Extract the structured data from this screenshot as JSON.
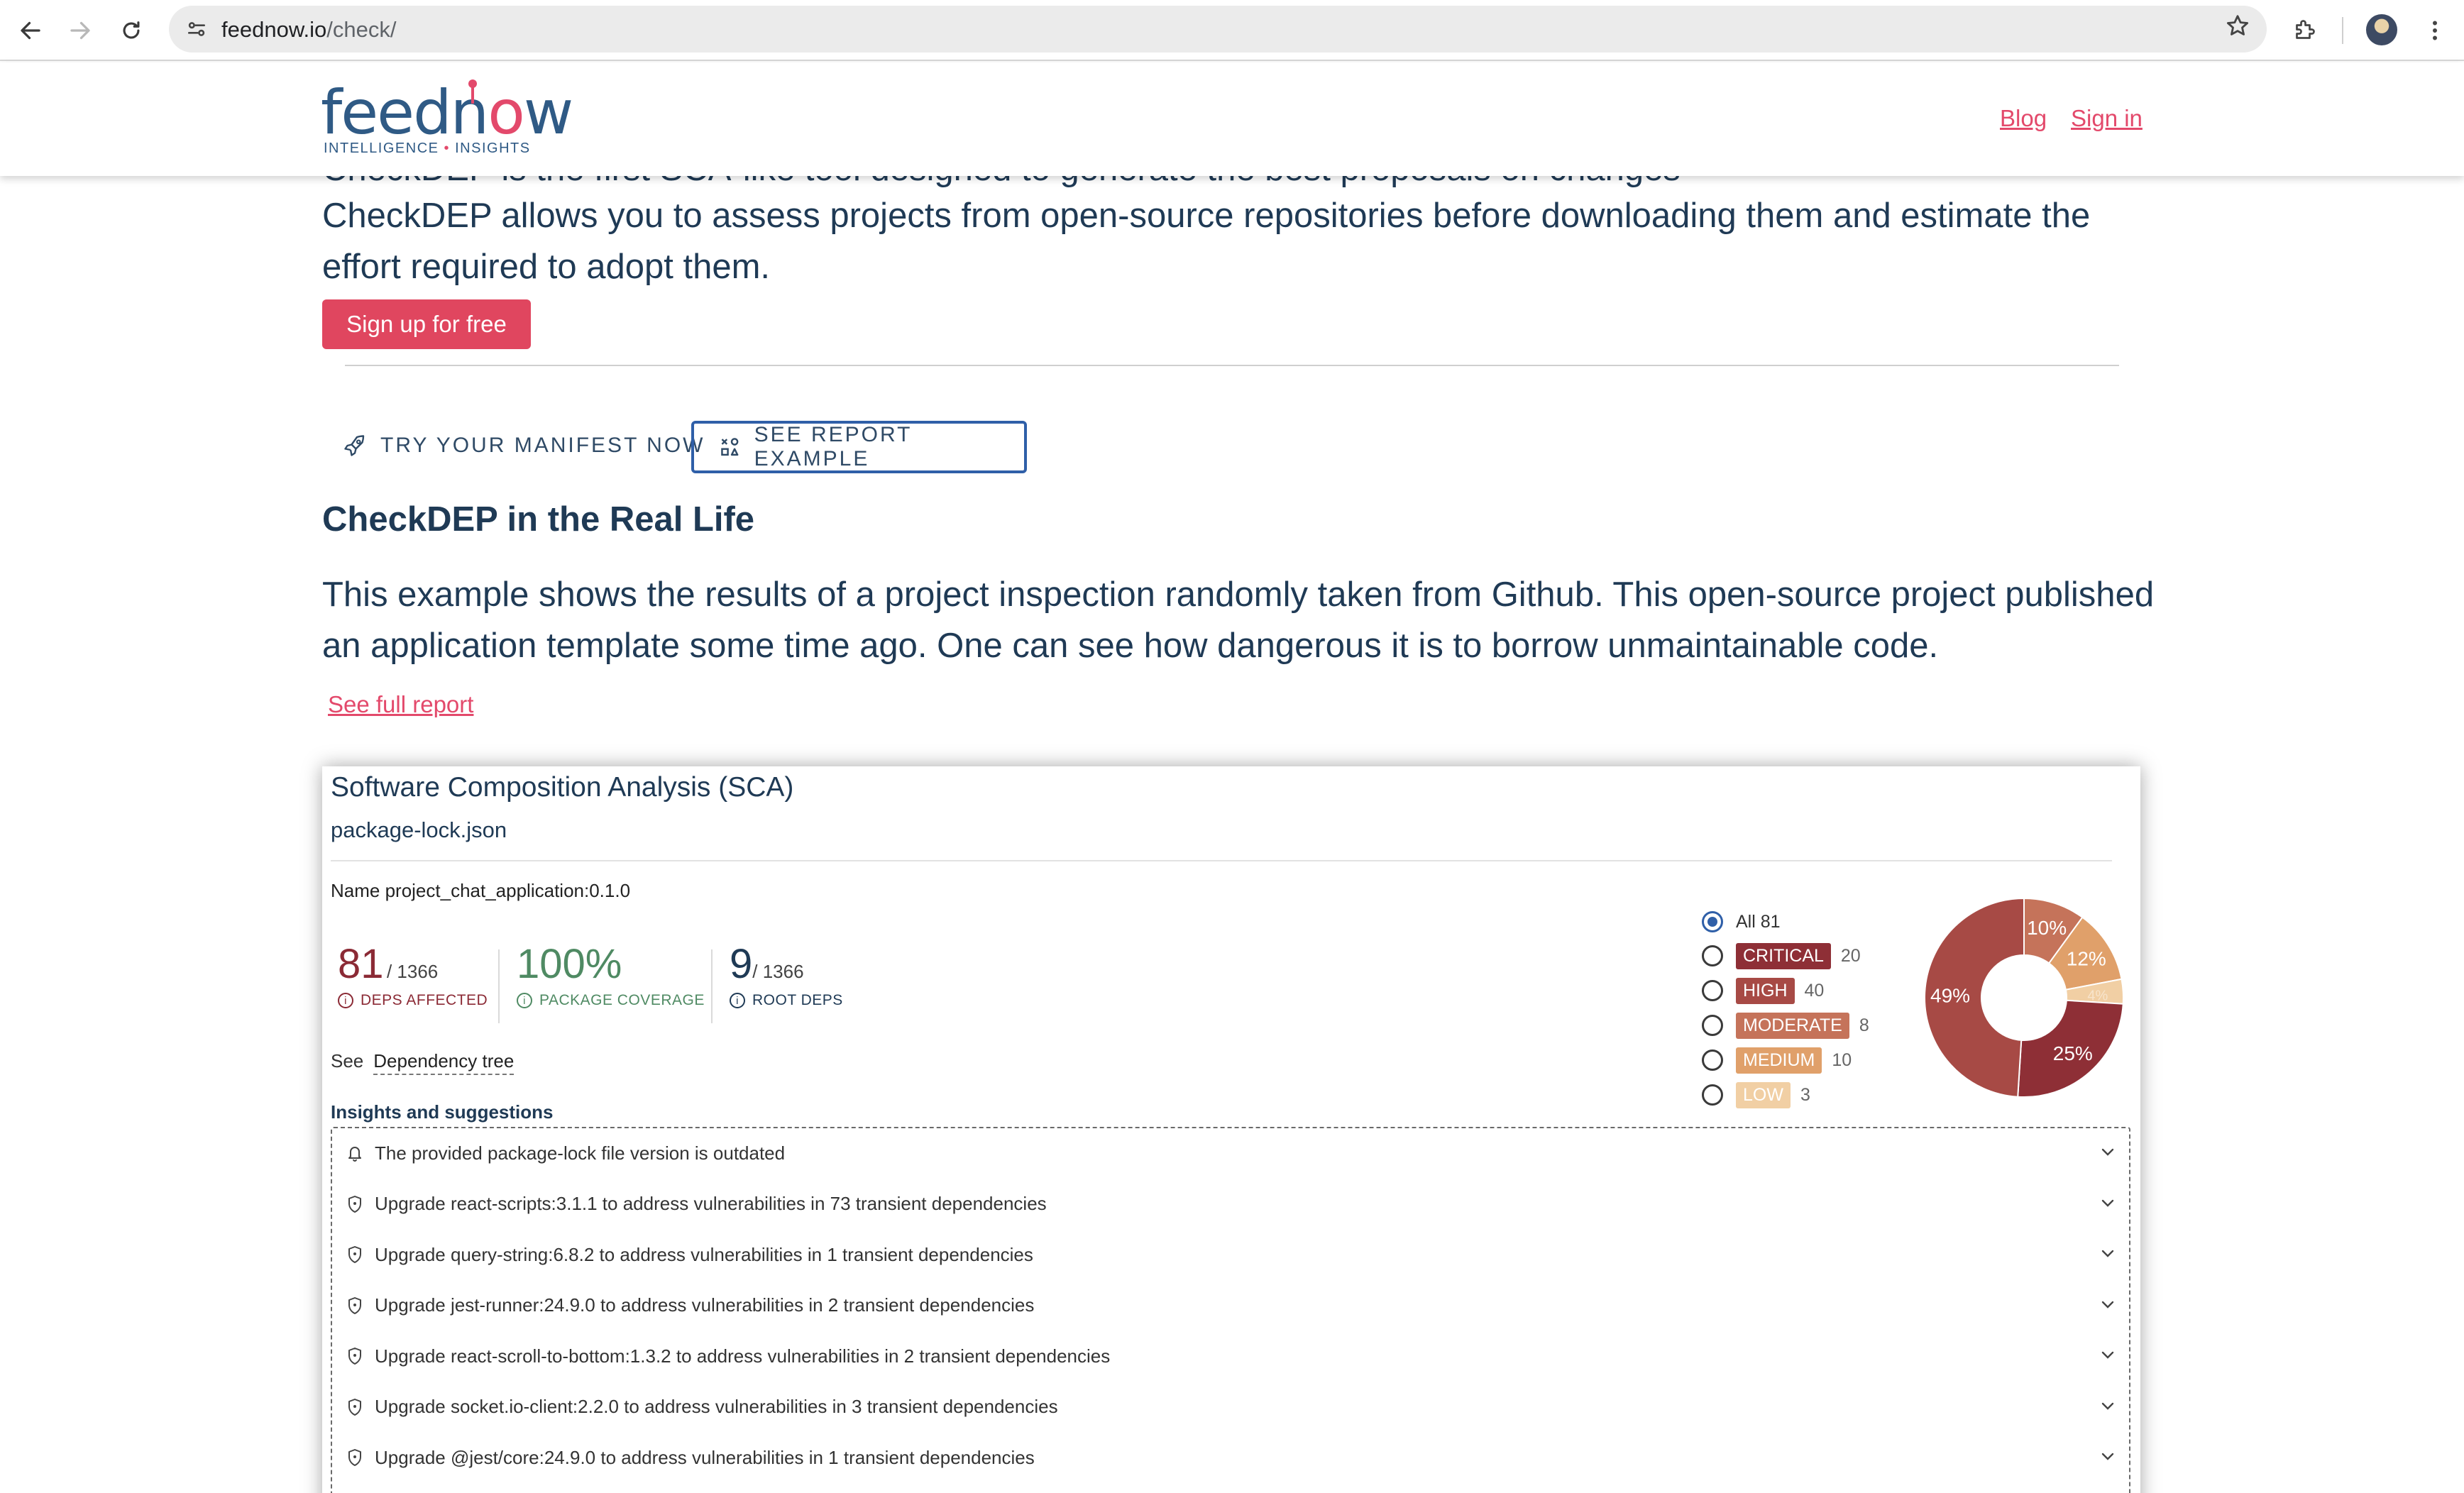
{
  "browser": {
    "url_host": "feednow.io",
    "url_path": "/check/"
  },
  "header": {
    "logo": {
      "word_a": "feedn",
      "word_o": "o",
      "word_b": "w",
      "tagline_a": "INTELLIGENCE",
      "tagline_dot": "•",
      "tagline_b": "INSIGHTS"
    },
    "links": [
      "Blog",
      "Sign in"
    ]
  },
  "intro": {
    "partial_line": "CheckDEP is the first SCA-like tool designed to generate the best proposals on changes",
    "text": "CheckDEP allows you to assess projects from open-source repositories before downloading them and estimate the effort required to adopt them.",
    "signup_label": "Sign up for free"
  },
  "tabs": {
    "try_label": "TRY YOUR MANIFEST NOW",
    "example_label": "SEE REPORT EXAMPLE"
  },
  "section": {
    "title": "CheckDEP in the Real Life",
    "text": "This example shows the results of a project inspection randomly taken from Github. This open-source project published an application template some time ago. One can see how dangerous it is to borrow unmaintainable code.",
    "full_report_link": "See full report"
  },
  "sca": {
    "title": "Software Composition Analysis (SCA)",
    "file": "package-lock.json",
    "name_line": "Name project_chat_application:0.1.0",
    "metrics": [
      {
        "value": "81",
        "total": "/ 1366",
        "label": "DEPS AFFECTED",
        "color": "#8b2a35"
      },
      {
        "value": "100%",
        "total": "",
        "label": "PACKAGE COVERAGE",
        "color": "#4f8a63"
      },
      {
        "value": "9",
        "total": "/ 1366",
        "label": "ROOT DEPS",
        "color": "#1f3a55"
      }
    ],
    "see_label": "See",
    "dependency_tree_link": "Dependency tree",
    "severity": {
      "all_label": "All 81",
      "levels": [
        {
          "label": "CRITICAL",
          "count": "20",
          "color": "#8e2f36"
        },
        {
          "label": "HIGH",
          "count": "40",
          "color": "#a74a45"
        },
        {
          "label": "MODERATE",
          "count": "8",
          "color": "#c5735a"
        },
        {
          "label": "MEDIUM",
          "count": "10",
          "color": "#e0a06a"
        },
        {
          "label": "LOW",
          "count": "3",
          "color": "#f1cfa4"
        }
      ]
    },
    "pie": {
      "slices": [
        {
          "label": "HIGH",
          "value": 49,
          "text": "49%",
          "color": "#a74a45"
        },
        {
          "label": "MODERATE",
          "value": 10,
          "text": "10%",
          "color": "#c5735a"
        },
        {
          "label": "MEDIUM",
          "value": 12,
          "text": "12%",
          "color": "#e0a06a"
        },
        {
          "label": "LOW",
          "value": 4,
          "text": "4%",
          "color": "#f1cfa4"
        },
        {
          "label": "CRITICAL",
          "value": 25,
          "text": "25%",
          "color": "#8e2f36"
        }
      ]
    },
    "insights_title": "Insights and suggestions",
    "insights": [
      {
        "icon": "bell-icon",
        "text": "The provided package-lock file version is outdated"
      },
      {
        "icon": "shield-icon",
        "text": "Upgrade react-scripts:3.1.1 to address vulnerabilities in 73 transient dependencies"
      },
      {
        "icon": "shield-icon",
        "text": "Upgrade query-string:6.8.2 to address vulnerabilities in 1 transient dependencies"
      },
      {
        "icon": "shield-icon",
        "text": "Upgrade jest-runner:24.9.0 to address vulnerabilities in 2 transient dependencies"
      },
      {
        "icon": "shield-icon",
        "text": "Upgrade react-scroll-to-bottom:1.3.2 to address vulnerabilities in 2 transient dependencies"
      },
      {
        "icon": "shield-icon",
        "text": "Upgrade socket.io-client:2.2.0 to address vulnerabilities in 3 transient dependencies"
      },
      {
        "icon": "shield-icon",
        "text": "Upgrade @jest/core:24.9.0 to address vulnerabilities in 1 transient dependencies"
      }
    ]
  }
}
